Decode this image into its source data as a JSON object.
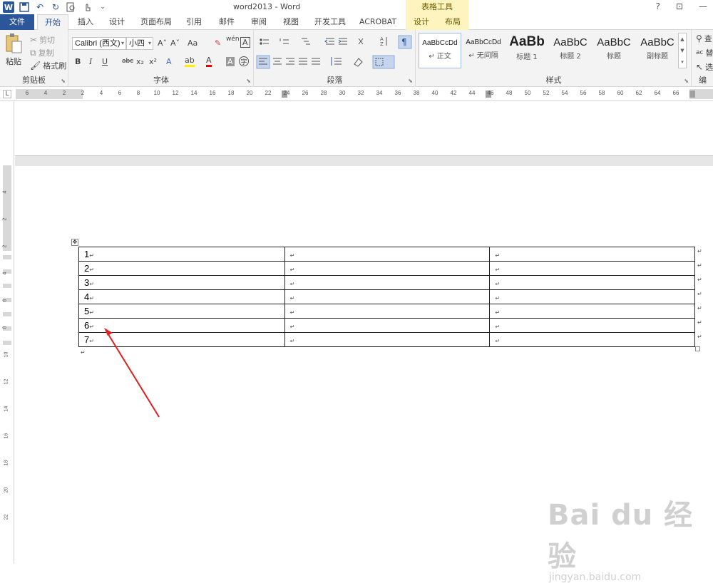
{
  "window": {
    "title": "word2013 - Word",
    "context_header": "表格工具",
    "help": "?",
    "ribbon_display": "⊡",
    "minimize": "—"
  },
  "qat": {
    "word_logo": "W",
    "save": "💾",
    "undo": "↶",
    "redo": "↻",
    "preview": "🔍",
    "touch": "✋",
    "more": "⌄"
  },
  "tabs": [
    "文件",
    "开始",
    "插入",
    "设计",
    "页面布局",
    "引用",
    "邮件",
    "审阅",
    "视图",
    "开发工具",
    "ACROBAT",
    "设计",
    "布局"
  ],
  "ribbon": {
    "clipboard": {
      "label": "剪贴板",
      "paste": "粘贴",
      "cut": "剪切",
      "copy": "复制",
      "format_painter": "格式刷"
    },
    "font": {
      "label": "字体",
      "font_name": "Calibri (西文)",
      "font_size": "小四",
      "grow": "A˄",
      "shrink": "A˅",
      "case": "Aa",
      "clear": "✎",
      "phonetic": "wén",
      "border_char": "A",
      "bold": "B",
      "italic": "I",
      "underline": "U",
      "strike": "abc",
      "sub": "x₂",
      "sup": "x²",
      "effect": "A",
      "highlight": "ab",
      "color": "A",
      "shade": "A",
      "enclose": "字"
    },
    "paragraph": {
      "label": "段落"
    },
    "styles": {
      "label": "样式",
      "items": [
        {
          "sample": "AaBbCcDd",
          "name": "正文"
        },
        {
          "sample": "AaBbCcDd",
          "name": "无间隔"
        },
        {
          "sample": "AaBb",
          "name": "标题 1"
        },
        {
          "sample": "AaBbC",
          "name": "标题 2"
        },
        {
          "sample": "AaBbC",
          "name": "标题"
        },
        {
          "sample": "AaBbC",
          "name": "副标题"
        }
      ]
    },
    "editing": {
      "label": "编",
      "find": "查",
      "replace": "替",
      "select": "选"
    }
  },
  "ruler": {
    "h_ticks": [
      "6",
      "4",
      "2",
      "2",
      "4",
      "6",
      "8",
      "10",
      "12",
      "14",
      "16",
      "18",
      "20",
      "22",
      "24",
      "26",
      "28",
      "30",
      "32",
      "34",
      "36",
      "38",
      "40",
      "42",
      "44",
      "46",
      "48",
      "50",
      "52",
      "54",
      "56",
      "58",
      "60",
      "62",
      "64",
      "66"
    ],
    "v_ticks": [
      "4",
      "2",
      "2",
      "4",
      "6",
      "8",
      "10",
      "12",
      "14",
      "16",
      "18",
      "20",
      "22"
    ]
  },
  "table": {
    "rows": [
      [
        "1",
        "",
        ""
      ],
      [
        "2",
        "",
        ""
      ],
      [
        "3",
        "",
        ""
      ],
      [
        "4",
        "",
        ""
      ],
      [
        "5",
        "",
        ""
      ],
      [
        "6",
        "",
        ""
      ],
      [
        "7",
        "",
        ""
      ]
    ],
    "paragraph_mark": "↵",
    "move_handle": "✥"
  },
  "watermark": {
    "main": "Bai du 经验",
    "sub": "jingyan.baidu.com"
  },
  "colors": {
    "word_blue": "#2b579a",
    "context_yellow": "#fdf4bf",
    "arrow_red": "#e02020"
  }
}
